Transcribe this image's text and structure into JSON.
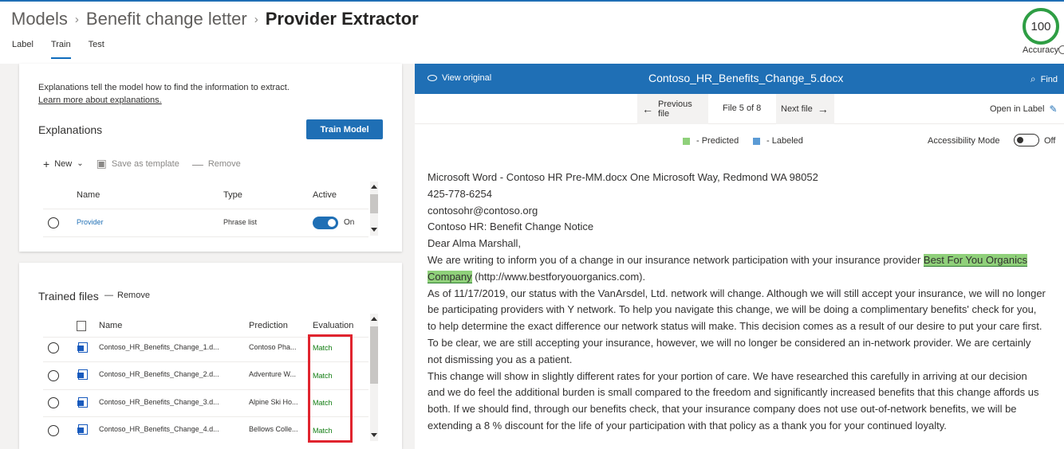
{
  "header": {
    "breadcrumb": [
      "Models",
      "Benefit change letter",
      "Provider Extractor"
    ],
    "tabs": [
      "Label",
      "Train",
      "Test"
    ],
    "active_tab": "Train",
    "accuracy_value": "100",
    "accuracy_label": "Accuracy"
  },
  "explanations_card": {
    "helper_text": "Explanations tell the model how to find the information to extract.",
    "learn_more": "Learn more about explanations.",
    "title": "Explanations",
    "train_button": "Train Model",
    "commands": {
      "new": "New",
      "save_template": "Save as template",
      "remove": "Remove"
    },
    "columns": {
      "name": "Name",
      "type": "Type",
      "active": "Active"
    },
    "rows": [
      {
        "name": "Provider",
        "type": "Phrase list",
        "active": "On"
      }
    ]
  },
  "trained_files_card": {
    "title": "Trained files",
    "remove": "Remove",
    "columns": {
      "name": "Name",
      "prediction": "Prediction",
      "evaluation": "Evaluation"
    },
    "rows": [
      {
        "name": "Contoso_HR_Benefits_Change_1.d...",
        "prediction": "Contoso Pha...",
        "evaluation": "Match"
      },
      {
        "name": "Contoso_HR_Benefits_Change_2.d...",
        "prediction": "Adventure W...",
        "evaluation": "Match"
      },
      {
        "name": "Contoso_HR_Benefits_Change_3.d...",
        "prediction": "Alpine Ski Ho...",
        "evaluation": "Match"
      },
      {
        "name": "Contoso_HR_Benefits_Change_4.d...",
        "prediction": "Bellows Colle...",
        "evaluation": "Match"
      }
    ]
  },
  "viewer": {
    "view_original": "View original",
    "file_title": "Contoso_HR_Benefits_Change_5.docx",
    "find": "Find",
    "previous_file": "Previous file",
    "file_position": "File 5 of 8",
    "next_file": "Next file",
    "open_in_label": "Open in Label",
    "legend_predicted": "- Predicted",
    "legend_labeled": "- Labeled",
    "accessibility_mode": "Accessibility Mode",
    "accessibility_state": "Off",
    "colors": {
      "predicted": "#8fd07a",
      "labeled": "#5b9bd5",
      "header": "#1f6fb5"
    },
    "document": {
      "line1": "Microsoft Word - Contoso HR Pre-MM.docx One Microsoft Way, Redmond WA 98052",
      "line2": "425-778-6254",
      "line3": "contosohr@contoso.org",
      "line4": "Contoso HR: Benefit Change Notice",
      "line5": "Dear Alma Marshall,",
      "para1_pre": "We are writing to inform you of a change in our insurance network participation with your insurance provider ",
      "para1_highlight": "Best For You Organics Company",
      "para1_post": " (http://www.bestforyouorganics.com).",
      "para2": "As of 11/17/2019, our status with the VanArsdel, Ltd. network will change. Although we will still accept your insurance, we will no longer be participating providers with Y network. To help you navigate this change, we will be doing a complimentary benefits' check for you, to help determine the exact difference our network status will make. This decision comes as a result of our desire to put your care first.",
      "para3": "To be clear, we are still accepting your insurance, however, we will no longer be considered an in-network provider. We are certainly not dismissing you as a patient.",
      "para4": "This change will show in slightly different rates for your portion of care. We have researched this carefully in arriving at our decision and we do feel the additional burden is small compared to the freedom and significantly increased benefits that this change affords us both. If we should find, through our benefits check, that your insurance company does not use out-of-network benefits, we will be extending a 8 % discount for the life of your participation with that policy as a thank you for your continued loyalty."
    }
  }
}
